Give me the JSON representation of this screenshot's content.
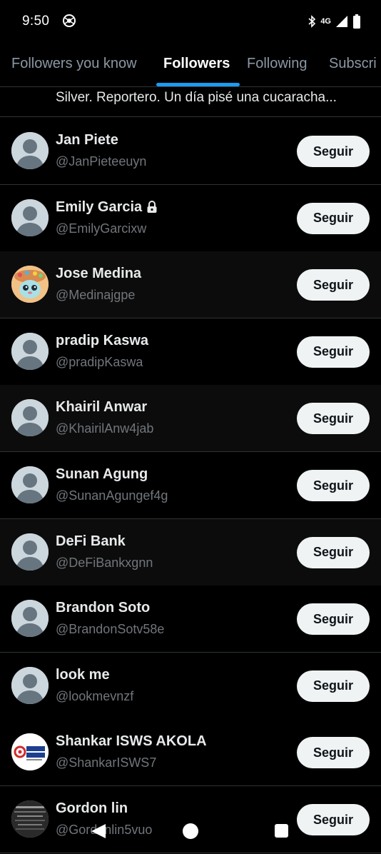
{
  "status_bar": {
    "time": "9:50",
    "network": "4G"
  },
  "tabs": [
    {
      "label": "Followers you know",
      "active": false
    },
    {
      "label": "Followers",
      "active": true
    },
    {
      "label": "Following",
      "active": false
    },
    {
      "label": "Subscri",
      "active": false
    }
  ],
  "partial_bio": "Silver.  Reportero. Un día pisé una cucaracha...",
  "follow_label": "Seguir",
  "users": [
    {
      "name": "Jan Piete",
      "handle": "@JanPieteeuyn",
      "avatar": "default-avatar",
      "protected": false
    },
    {
      "name": "Emily Garcia",
      "handle": "@EmilyGarcixw",
      "avatar": "default-avatar",
      "protected": true
    },
    {
      "name": "Jose Medina",
      "handle": "@Medinajgpe",
      "avatar": "cartoon-cat-avatar",
      "protected": false
    },
    {
      "name": "pradip Kaswa",
      "handle": "@pradipKaswa",
      "avatar": "default-avatar",
      "protected": false
    },
    {
      "name": "Khairil Anwar",
      "handle": "@KhairilAnw4jab",
      "avatar": "default-avatar",
      "protected": false
    },
    {
      "name": "Sunan Agung",
      "handle": "@SunanAgungef4g",
      "avatar": "default-avatar",
      "protected": false
    },
    {
      "name": "DeFi Bank",
      "handle": "@DeFiBankxgnn",
      "avatar": "default-avatar",
      "protected": false
    },
    {
      "name": "Brandon Soto",
      "handle": "@BrandonSotv58e",
      "avatar": "default-avatar",
      "protected": false
    },
    {
      "name": "look me",
      "handle": "@lookmevnzf",
      "avatar": "default-avatar",
      "protected": false
    },
    {
      "name": "Shankar ISWS AKOLA",
      "handle": "@ShankarISWS7",
      "avatar": "just-rights-logo-avatar",
      "protected": false,
      "logo_text": "JUST RIGHTS"
    },
    {
      "name": "Gordon lin",
      "handle": "@Gordonlin5vuo",
      "avatar": "dark-photo-avatar",
      "protected": false
    }
  ],
  "colors": {
    "background": "#000000",
    "accent": "#1d9bf0",
    "secondary_text": "#71767b",
    "button_bg": "#eff3f4"
  }
}
